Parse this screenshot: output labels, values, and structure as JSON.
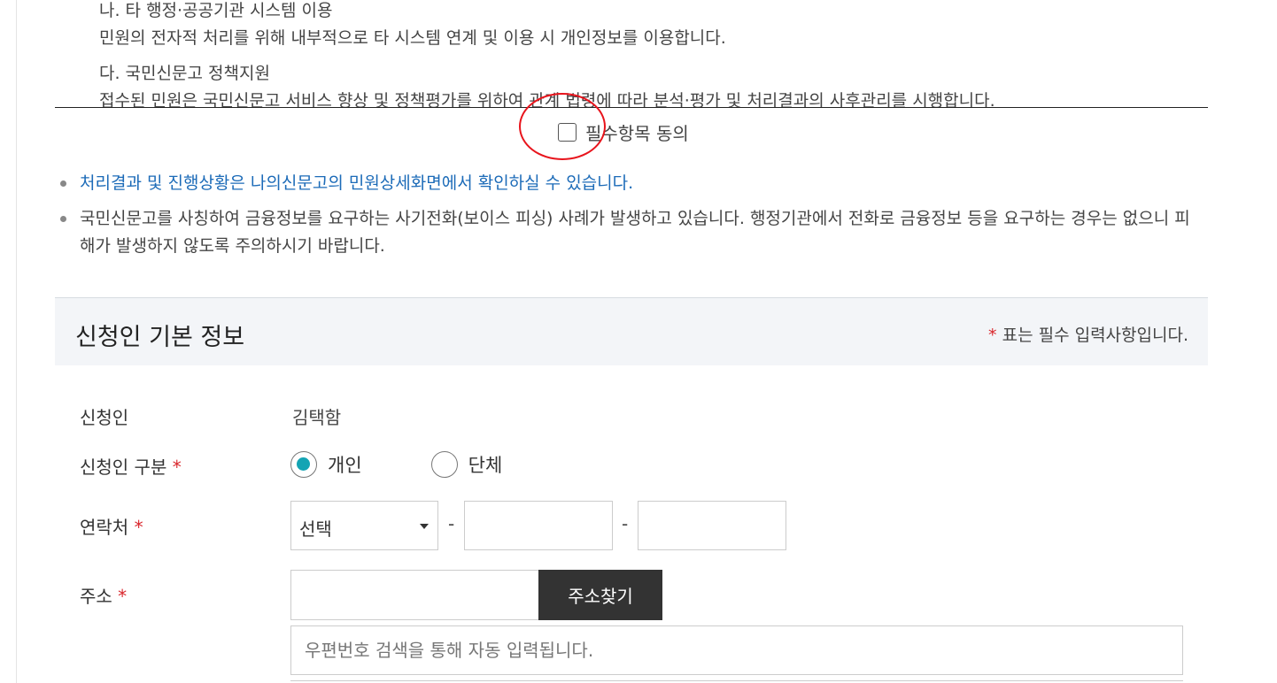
{
  "terms": {
    "items": [
      {
        "heading": "나. 타 행정·공공기관 시스템 이용",
        "body": "민원의 전자적 처리를 위해 내부적으로 타 시스템 연계 및 이용 시 개인정보를 이용합니다."
      },
      {
        "heading": "다. 국민신문고 정책지원",
        "body": "접수된 민원은 국민신문고 서비스 향상 및 정책평가를 위하여 관계 법령에 따라 분석·평가 및 처리결과의 사후관리를 시행합니다."
      }
    ]
  },
  "agree": {
    "label": "필수항목 동의",
    "checked": false
  },
  "notices": [
    "처리결과 및 진행상황은 나의신문고의 민원상세화면에서 확인하실 수 있습니다.",
    "국민신문고를 사칭하여 금융정보를 요구하는 사기전화(보이스 피싱) 사례가 발생하고 있습니다. 행정기관에서 전화로 금융정보 등을 요구하는 경우는 없으니 피해가 발생하지 않도록 주의하시기 바랍니다."
  ],
  "section": {
    "title": "신청인 기본 정보",
    "required_mark": "*",
    "required_note": " 표는 필수 입력사항입니다."
  },
  "form": {
    "applicant": {
      "label": "신청인",
      "value": "김택함"
    },
    "applicant_type": {
      "label": "신청인 구분",
      "required_mark": "*",
      "options": [
        "개인",
        "단체"
      ],
      "selected": "개인"
    },
    "contact": {
      "label": "연락처",
      "required_mark": "*",
      "select_value": "선택",
      "separator": "-",
      "middle_value": "",
      "last_value": ""
    },
    "address": {
      "label": "주소",
      "required_mark": "*",
      "postcode_value": "",
      "search_button": "주소찾기",
      "auto_placeholder": "우편번호 검색을 통해 자동 입력됩니다."
    }
  },
  "colors": {
    "link": "#1c6bb8",
    "required": "#d9262c",
    "radio_checked": "#14a4b4",
    "annotation": "#e8141c",
    "button_bg": "#333333"
  }
}
